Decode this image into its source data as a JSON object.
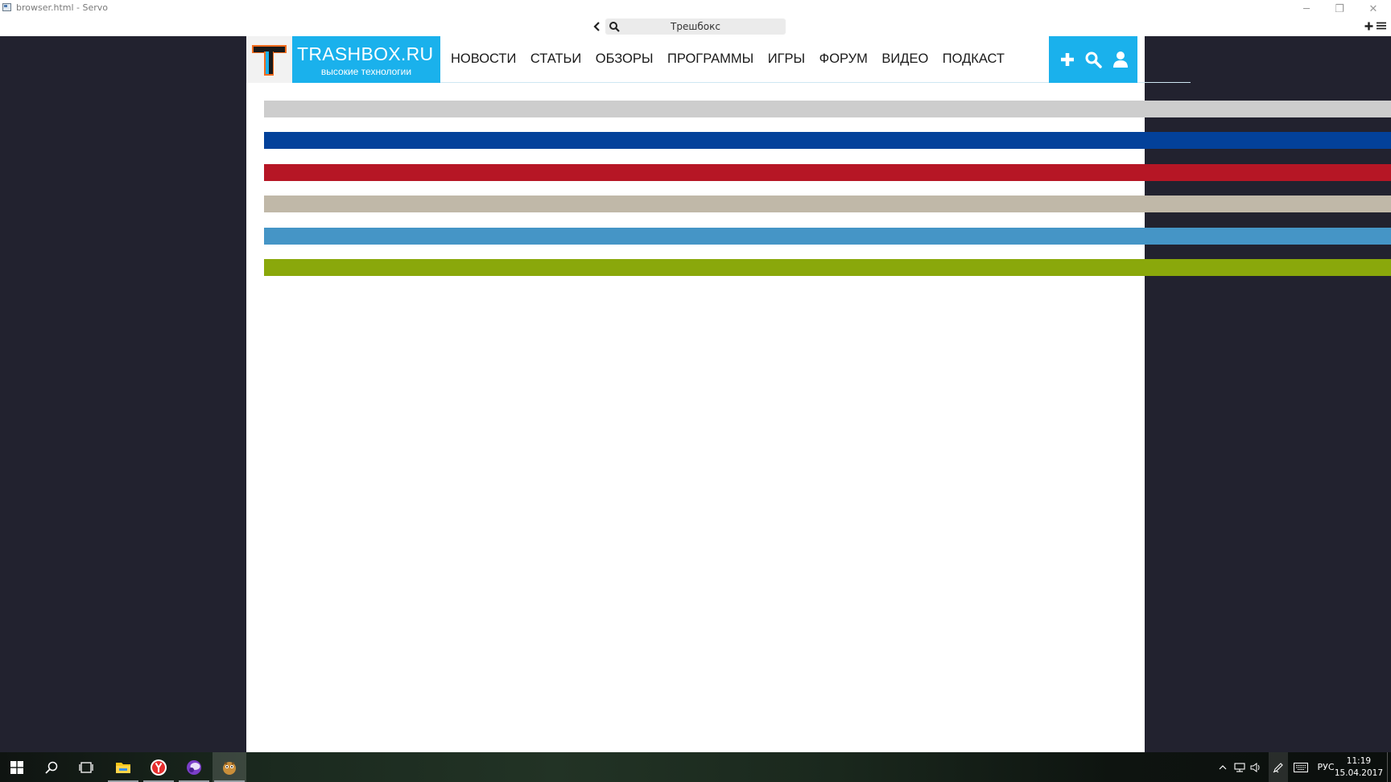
{
  "window": {
    "title": "browser.html - Servo",
    "minimize_glyph": "─",
    "restore_glyph": "❐",
    "close_glyph": "✕"
  },
  "toolbar": {
    "address_value": "Трешбокс",
    "back_icon": "chevron-left-icon",
    "search_icon": "search-icon",
    "new_tab_icon": "plus-icon",
    "menu_icon": "hamburger-menu-icon"
  },
  "site": {
    "logo_text": "TRASHBOX.RU",
    "logo_tagline": "высокие технологии",
    "nav": [
      "НОВОСТИ",
      "СТАТЬИ",
      "ОБЗОРЫ",
      "ПРОГРАММЫ",
      "ИГРЫ",
      "ФОРУМ",
      "ВИДЕО",
      "ПОДКАСТ"
    ],
    "actions": [
      {
        "icon": "plus-icon"
      },
      {
        "icon": "search-icon"
      },
      {
        "icon": "user-icon"
      }
    ],
    "accent_color": "#1ab1ec"
  },
  "loading_bars": [
    {
      "color": "#cdcdcd"
    },
    {
      "color": "#03419a"
    },
    {
      "color": "#b61625"
    },
    {
      "color": "#c0b8a8"
    },
    {
      "color": "#4595c6"
    },
    {
      "color": "#8aa80b"
    }
  ],
  "taskbar": {
    "apps": [
      "windows-start-icon",
      "search-icon",
      "task-view-icon",
      "file-explorer-icon",
      "yandex-browser-icon",
      "purple-app-icon",
      "servo-app-icon"
    ],
    "language": "РУС",
    "time": "11:19",
    "date": "15.04.2017"
  }
}
